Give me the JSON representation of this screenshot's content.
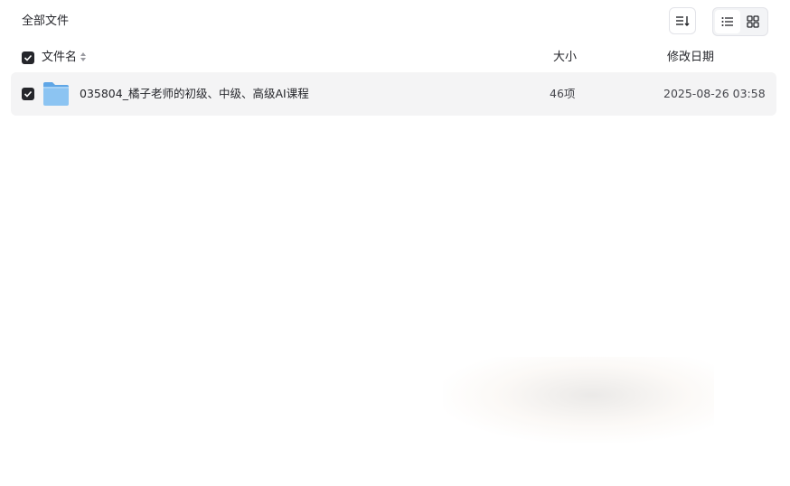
{
  "breadcrumb": {
    "title": "全部文件"
  },
  "toolbar": {
    "sort_icon": "sort-lines-icon",
    "view_modes": [
      {
        "name": "list",
        "icon": "list-icon",
        "active": true
      },
      {
        "name": "grid",
        "icon": "grid-icon",
        "active": false
      }
    ]
  },
  "table": {
    "columns": {
      "name": "文件名",
      "size": "大小",
      "modified": "修改日期"
    },
    "rows": [
      {
        "type": "folder",
        "icon": "folder-icon",
        "checked": true,
        "name": "035804_橘子老师的初级、中级、高级AI课程",
        "size": "46项",
        "modified": "2025-08-26 03:58"
      }
    ]
  },
  "colors": {
    "row_background": "#f4f4f5",
    "checkbox": "#25262b",
    "folder": "#7cb8ee"
  }
}
